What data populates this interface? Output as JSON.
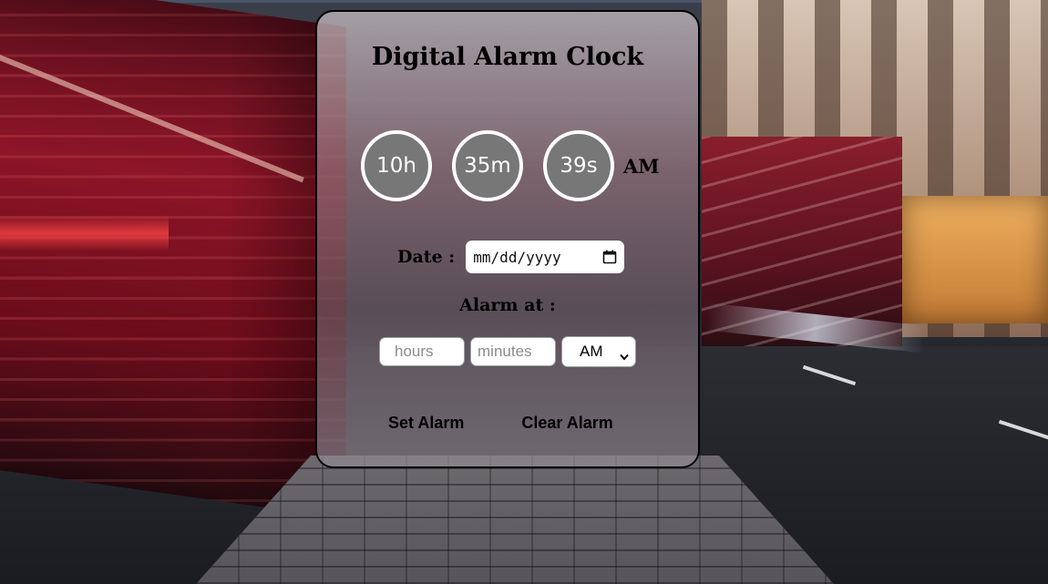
{
  "app": {
    "title": "Digital Alarm Clock"
  },
  "clock": {
    "hours": "10h",
    "minutes": "35m",
    "seconds": "39s",
    "period": "AM"
  },
  "date": {
    "label": "Date :",
    "value": "mm/dd/yyyy",
    "icon": "calendar-icon"
  },
  "alarm": {
    "label": "Alarm at :",
    "hours_placeholder": "hours",
    "minutes_placeholder": "minutes",
    "period_selected": "AM",
    "set_button": "Set Alarm",
    "clear_button": "Clear Alarm"
  },
  "colors": {
    "circle_fill": "#777777",
    "circle_border": "#ffffff",
    "card_border": "#000000"
  }
}
